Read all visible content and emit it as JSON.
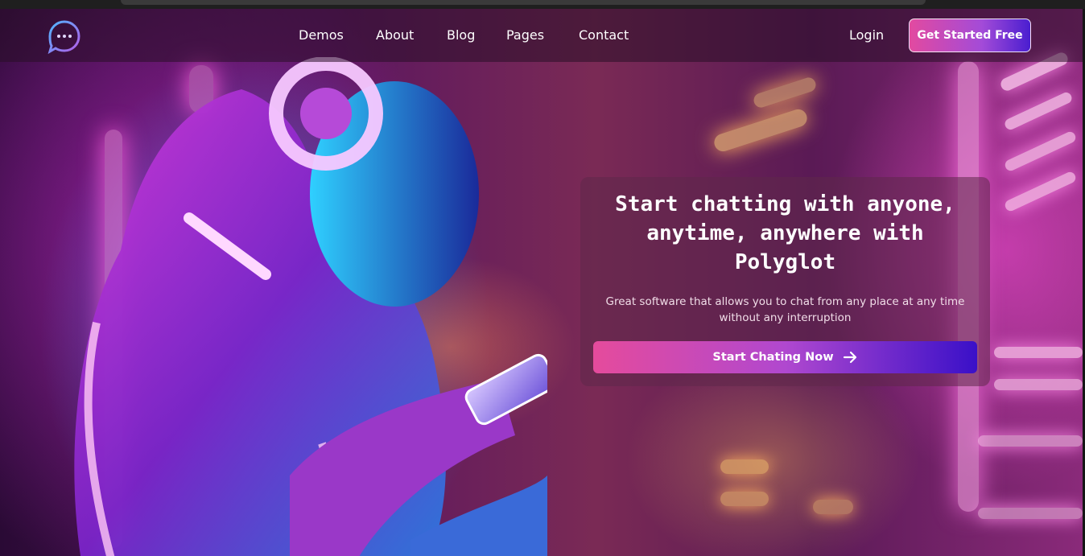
{
  "nav": {
    "logo_icon": "chat-bubble-icon",
    "links": [
      "Demos",
      "About",
      "Blog",
      "Pages",
      "Contact"
    ],
    "login": "Login",
    "cta": "Get Started Free"
  },
  "hero": {
    "title_lines": [
      "Start chatting with anyone,",
      "anytime, anywhere with",
      "Polyglot"
    ],
    "subtitle_lines": [
      "Great software that allows you to chat from any place at any time",
      "without any interruption"
    ],
    "cta_label": "Start Chating Now",
    "cta_icon": "arrow-right-icon"
  },
  "colors": {
    "accent_start": "#e24aa0",
    "accent_end": "#3a10c8"
  }
}
